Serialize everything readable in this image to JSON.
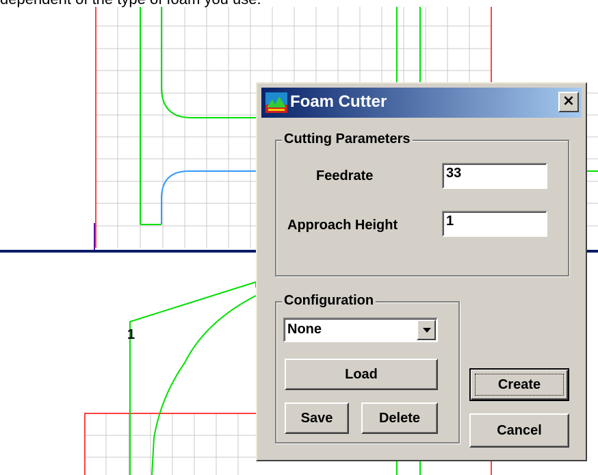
{
  "background": {
    "partial_text": "dependent of the type of foam you use.",
    "path_label": "1",
    "colors": {
      "grid": "#c8c8c8",
      "red": "#ff0000",
      "green": "#00e000",
      "blue": "#3399ff",
      "axis": "#001a66"
    }
  },
  "dialog": {
    "title": "Foam Cutter",
    "close_label": "×",
    "cutting_parameters": {
      "group_label": "Cutting Parameters",
      "feedrate_label": "Feedrate",
      "feedrate_value": "33",
      "approach_height_label": "Approach Height",
      "approach_height_value": "1"
    },
    "configuration": {
      "group_label": "Configuration",
      "selected": "None",
      "load_label": "Load",
      "save_label": "Save",
      "delete_label": "Delete"
    },
    "create_label": "Create",
    "cancel_label": "Cancel"
  }
}
